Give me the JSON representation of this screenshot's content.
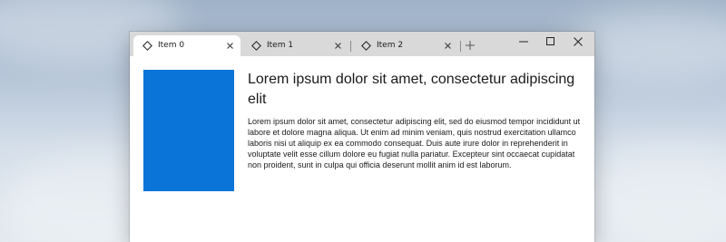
{
  "window": {
    "tabs": [
      {
        "label": "Item 0",
        "active": true,
        "icon": "diamond-icon"
      },
      {
        "label": "Item 1",
        "active": false,
        "icon": "diamond-icon"
      },
      {
        "label": "Item 2",
        "active": false,
        "icon": "diamond-icon"
      }
    ],
    "add_tab_icon": "plus-icon",
    "caption_buttons": [
      "minimize-icon",
      "maximize-icon",
      "close-icon"
    ]
  },
  "content": {
    "image_color": "#0a74d8",
    "title": "Lorem ipsum dolor sit amet, consectetur adipiscing elit",
    "body": "Lorem ipsum dolor sit amet, consectetur adipiscing elit, sed do eiusmod tempor incididunt ut labore et dolore magna aliqua. Ut enim ad minim veniam, quis nostrud exercitation ullamco laboris nisi ut aliquip ex ea commodo consequat. Duis aute irure dolor in reprehenderit in voluptate velit esse cillum dolore eu fugiat nulla pariatur. Excepteur sint occaecat cupidatat non proident, sunt in culpa qui officia deserunt mollit anim id est laborum."
  }
}
